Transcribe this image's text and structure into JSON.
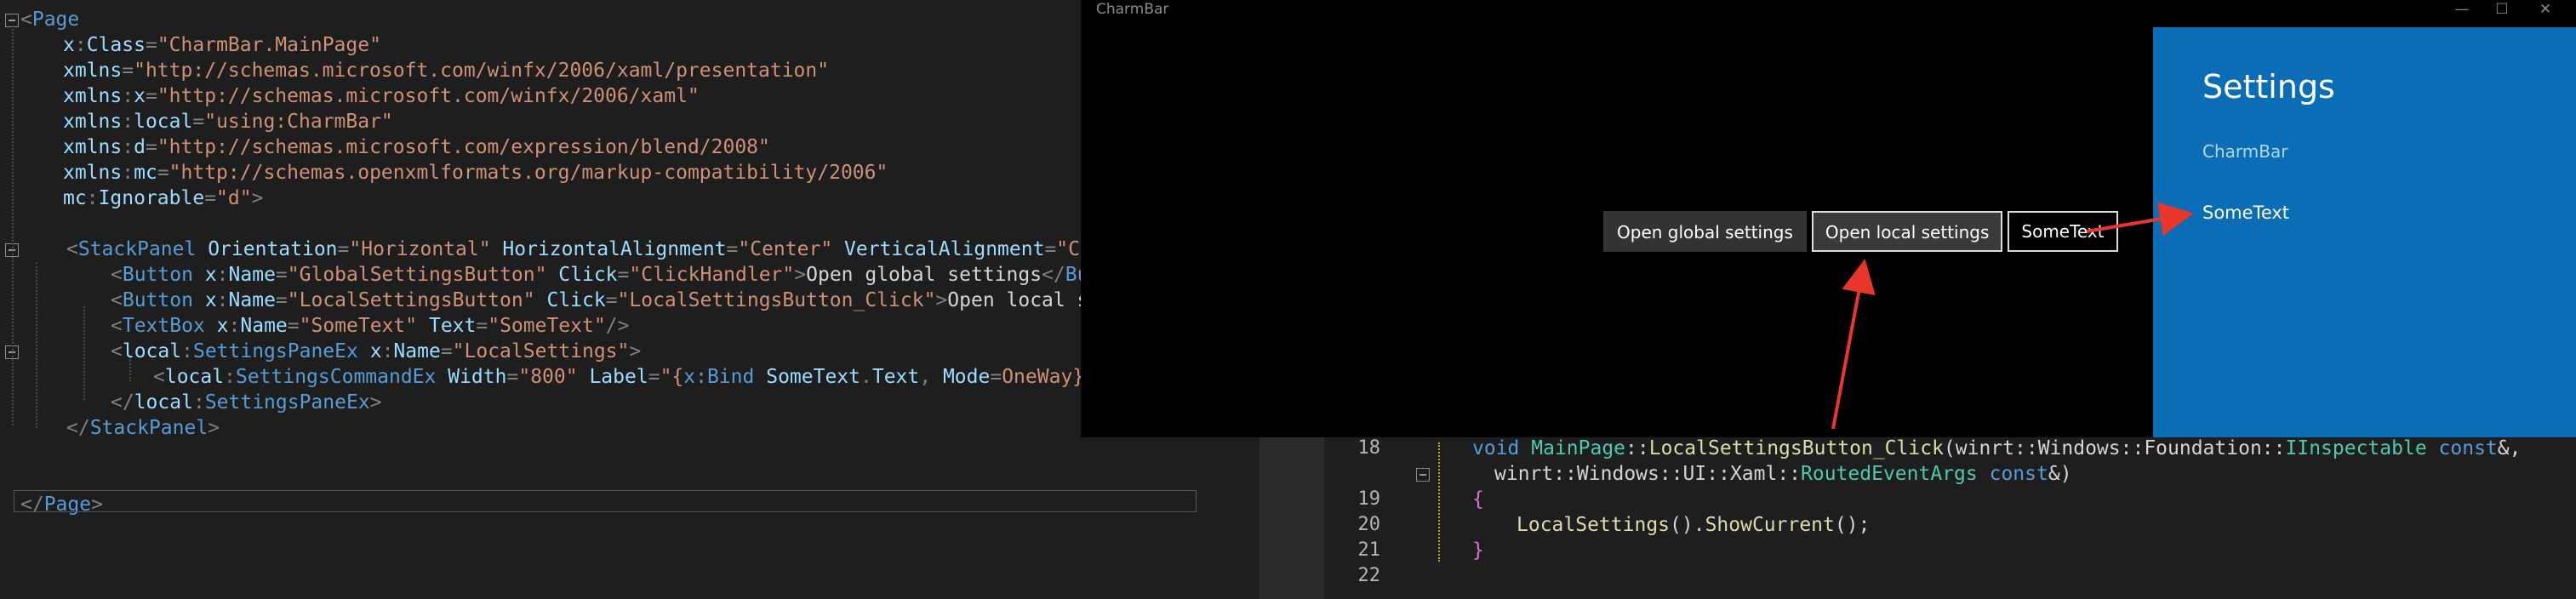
{
  "xaml": {
    "lines": [
      {
        "tokens": [
          [
            "tok-punc",
            "<"
          ],
          [
            "tok-tag",
            "Page"
          ]
        ]
      },
      {
        "tokens": [
          [
            "tok-prefix",
            "x"
          ],
          [
            "tok-punc",
            ":"
          ],
          [
            "tok-attr",
            "Class"
          ],
          [
            "tok-punc",
            "="
          ],
          [
            "tok-str",
            "\"CharmBar.MainPage\""
          ]
        ]
      },
      {
        "tokens": [
          [
            "tok-attr",
            "xmlns"
          ],
          [
            "tok-punc",
            "="
          ],
          [
            "tok-str",
            "\"http://schemas.microsoft.com/winfx/2006/xaml/presentation\""
          ]
        ]
      },
      {
        "tokens": [
          [
            "tok-attr",
            "xmlns"
          ],
          [
            "tok-punc",
            ":"
          ],
          [
            "tok-attr",
            "x"
          ],
          [
            "tok-punc",
            "="
          ],
          [
            "tok-str",
            "\"http://schemas.microsoft.com/winfx/2006/xaml\""
          ]
        ]
      },
      {
        "tokens": [
          [
            "tok-attr",
            "xmlns"
          ],
          [
            "tok-punc",
            ":"
          ],
          [
            "tok-attr",
            "local"
          ],
          [
            "tok-punc",
            "="
          ],
          [
            "tok-str",
            "\"using:CharmBar\""
          ]
        ]
      },
      {
        "tokens": [
          [
            "tok-attr",
            "xmlns"
          ],
          [
            "tok-punc",
            ":"
          ],
          [
            "tok-attr",
            "d"
          ],
          [
            "tok-punc",
            "="
          ],
          [
            "tok-str",
            "\"http://schemas.microsoft.com/expression/blend/2008\""
          ]
        ]
      },
      {
        "tokens": [
          [
            "tok-attr",
            "xmlns"
          ],
          [
            "tok-punc",
            ":"
          ],
          [
            "tok-attr",
            "mc"
          ],
          [
            "tok-punc",
            "="
          ],
          [
            "tok-str",
            "\"http://schemas.openxmlformats.org/markup-compatibility/2006\""
          ]
        ]
      },
      {
        "tokens": [
          [
            "tok-prefix",
            "mc"
          ],
          [
            "tok-punc",
            ":"
          ],
          [
            "tok-attr",
            "Ignorable"
          ],
          [
            "tok-punc",
            "="
          ],
          [
            "tok-str",
            "\"d\""
          ],
          [
            "tok-punc",
            ">"
          ]
        ]
      },
      {
        "tokens": []
      },
      {
        "tokens": [
          [
            "tok-punc",
            "<"
          ],
          [
            "tok-tag",
            "StackPanel"
          ],
          [
            "tok-text",
            " "
          ],
          [
            "tok-attr",
            "Orientation"
          ],
          [
            "tok-punc",
            "="
          ],
          [
            "tok-str",
            "\"Horizontal\""
          ],
          [
            "tok-text",
            " "
          ],
          [
            "tok-attr",
            "HorizontalAlignment"
          ],
          [
            "tok-punc",
            "="
          ],
          [
            "tok-str",
            "\"Center\""
          ],
          [
            "tok-text",
            " "
          ],
          [
            "tok-attr",
            "VerticalAlignment"
          ],
          [
            "tok-punc",
            "="
          ],
          [
            "tok-str",
            "\"Center\""
          ]
        ]
      },
      {
        "tokens": [
          [
            "tok-punc",
            "<"
          ],
          [
            "tok-tag",
            "Button"
          ],
          [
            "tok-text",
            " "
          ],
          [
            "tok-prefix",
            "x"
          ],
          [
            "tok-punc",
            ":"
          ],
          [
            "tok-attr",
            "Name"
          ],
          [
            "tok-punc",
            "="
          ],
          [
            "tok-str",
            "\"GlobalSettingsButton\""
          ],
          [
            "tok-text",
            " "
          ],
          [
            "tok-attr",
            "Click"
          ],
          [
            "tok-punc",
            "="
          ],
          [
            "tok-str",
            "\"ClickHandler\""
          ],
          [
            "tok-punc",
            ">"
          ],
          [
            "tok-text",
            "Open global settings"
          ],
          [
            "tok-punc",
            "</"
          ],
          [
            "tok-tag",
            "Button"
          ],
          [
            "tok-punc",
            ">"
          ]
        ]
      },
      {
        "tokens": [
          [
            "tok-punc",
            "<"
          ],
          [
            "tok-tag",
            "Button"
          ],
          [
            "tok-text",
            " "
          ],
          [
            "tok-prefix",
            "x"
          ],
          [
            "tok-punc",
            ":"
          ],
          [
            "tok-attr",
            "Name"
          ],
          [
            "tok-punc",
            "="
          ],
          [
            "tok-str",
            "\"LocalSettingsButton\""
          ],
          [
            "tok-text",
            " "
          ],
          [
            "tok-attr",
            "Click"
          ],
          [
            "tok-punc",
            "="
          ],
          [
            "tok-str",
            "\"LocalSettingsButton_Click\""
          ],
          [
            "tok-punc",
            ">"
          ],
          [
            "tok-text",
            "Open local settin"
          ]
        ]
      },
      {
        "tokens": [
          [
            "tok-punc",
            "<"
          ],
          [
            "tok-tag",
            "TextBox"
          ],
          [
            "tok-text",
            " "
          ],
          [
            "tok-prefix",
            "x"
          ],
          [
            "tok-punc",
            ":"
          ],
          [
            "tok-attr",
            "Name"
          ],
          [
            "tok-punc",
            "="
          ],
          [
            "tok-str",
            "\"SomeText\""
          ],
          [
            "tok-text",
            " "
          ],
          [
            "tok-attr",
            "Text"
          ],
          [
            "tok-punc",
            "="
          ],
          [
            "tok-str",
            "\"SomeText\""
          ],
          [
            "tok-punc",
            "/>"
          ]
        ]
      },
      {
        "tokens": [
          [
            "tok-punc",
            "<"
          ],
          [
            "tok-prefix",
            "local"
          ],
          [
            "tok-punc",
            ":"
          ],
          [
            "tok-tag",
            "SettingsPaneEx"
          ],
          [
            "tok-text",
            " "
          ],
          [
            "tok-prefix",
            "x"
          ],
          [
            "tok-punc",
            ":"
          ],
          [
            "tok-attr",
            "Name"
          ],
          [
            "tok-punc",
            "="
          ],
          [
            "tok-str",
            "\"LocalSettings\""
          ],
          [
            "tok-punc",
            ">"
          ]
        ]
      },
      {
        "tokens": [
          [
            "tok-punc",
            "<"
          ],
          [
            "tok-prefix",
            "local"
          ],
          [
            "tok-punc",
            ":"
          ],
          [
            "tok-tag",
            "SettingsCommandEx"
          ],
          [
            "tok-text",
            " "
          ],
          [
            "tok-attr",
            "Width"
          ],
          [
            "tok-punc",
            "="
          ],
          [
            "tok-str",
            "\"800\""
          ],
          [
            "tok-text",
            " "
          ],
          [
            "tok-attr",
            "Label"
          ],
          [
            "tok-punc",
            "="
          ],
          [
            "tok-str",
            "\"{"
          ],
          [
            "tok-tag",
            "x:Bind"
          ],
          [
            "tok-text",
            " "
          ],
          [
            "tok-attr",
            "SomeText"
          ],
          [
            "tok-punc",
            "."
          ],
          [
            "tok-attr",
            "Text"
          ],
          [
            "tok-punc",
            ", "
          ],
          [
            "tok-attr",
            "Mode"
          ],
          [
            "tok-punc",
            "="
          ],
          [
            "tok-str",
            "OneWay}\""
          ],
          [
            "tok-punc",
            "/>"
          ]
        ]
      },
      {
        "tokens": [
          [
            "tok-punc",
            "</"
          ],
          [
            "tok-prefix",
            "local"
          ],
          [
            "tok-punc",
            ":"
          ],
          [
            "tok-tag",
            "SettingsPaneEx"
          ],
          [
            "tok-punc",
            ">"
          ]
        ]
      },
      {
        "tokens": [
          [
            "tok-punc",
            "</"
          ],
          [
            "tok-tag",
            "StackPanel"
          ],
          [
            "tok-punc",
            ">"
          ]
        ]
      },
      {
        "tokens": []
      },
      {
        "tokens": []
      },
      {
        "tokens": [
          [
            "tok-punc",
            "</"
          ],
          [
            "tok-tag",
            "Page"
          ],
          [
            "tok-punc",
            ">"
          ]
        ]
      }
    ]
  },
  "cpp": {
    "lines": [
      {
        "num": "18",
        "tokens": [
          [
            "c-kw",
            "void "
          ],
          [
            "c-type",
            "MainPage"
          ],
          [
            "c-text",
            "::"
          ],
          [
            "c-fn",
            "LocalSettingsButton_Click"
          ],
          [
            "c-text",
            "(winrt::Windows::Foundation::"
          ],
          [
            "c-type",
            "IInspectable"
          ],
          [
            "c-text",
            " "
          ],
          [
            "c-kw",
            "const"
          ],
          [
            "c-text",
            "&,"
          ]
        ]
      },
      {
        "num": "",
        "tokens": [
          [
            "c-text",
            "winrt::Windows::UI::Xaml::"
          ],
          [
            "c-type",
            "RoutedEventArgs"
          ],
          [
            "c-text",
            " "
          ],
          [
            "c-kw",
            "const"
          ],
          [
            "c-text",
            "&)"
          ]
        ]
      },
      {
        "num": "19",
        "tokens": [
          [
            "c-brace",
            "{"
          ]
        ]
      },
      {
        "num": "20",
        "tokens": [
          [
            "c-fn",
            "LocalSettings"
          ],
          [
            "c-text",
            "()."
          ],
          [
            "c-fn",
            "ShowCurrent"
          ],
          [
            "c-text",
            "();"
          ]
        ]
      },
      {
        "num": "21",
        "tokens": [
          [
            "c-brace",
            "}"
          ]
        ]
      },
      {
        "num": "22",
        "tokens": []
      }
    ]
  },
  "app": {
    "title": "CharmBar",
    "minimize_glyph": "—",
    "maximize_glyph": "☐",
    "close_glyph": "✕",
    "global_button": "Open global settings",
    "local_button": "Open local settings",
    "textbox_value": "SomeText"
  },
  "settings_pane": {
    "title": "Settings",
    "app_name": "CharmBar",
    "command_label": "SomeText",
    "accent_color": "#0a6db5"
  },
  "annotation_color": "#e8372a"
}
